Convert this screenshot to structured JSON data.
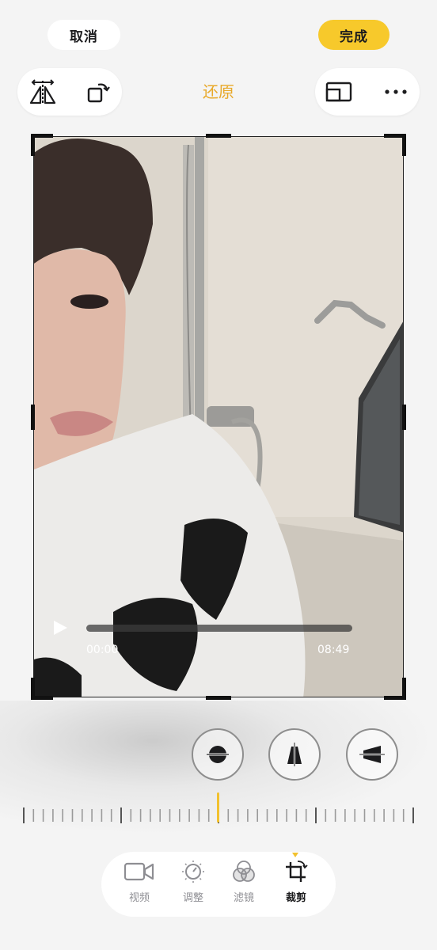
{
  "header": {
    "cancel_label": "取消",
    "done_label": "完成",
    "reset_label": "还原"
  },
  "toolbar": {
    "left_icons": [
      "flip-horizontal-icon",
      "rotate-icon"
    ],
    "right_icons": [
      "aspect-ratio-icon",
      "more-icon"
    ]
  },
  "video": {
    "current_time": "00:00",
    "duration": "08:49",
    "progress": 0
  },
  "adjust_buttons": [
    "straighten-icon",
    "vertical-perspective-icon",
    "horizontal-perspective-icon"
  ],
  "tabs": [
    {
      "label": "视频",
      "icon": "video-camera-icon"
    },
    {
      "label": "调整",
      "icon": "adjust-dial-icon"
    },
    {
      "label": "滤镜",
      "icon": "filters-icon"
    },
    {
      "label": "裁剪",
      "icon": "crop-rotate-icon",
      "active": true
    }
  ],
  "colors": {
    "accent": "#f7c92b",
    "reset_text": "#e8a92a",
    "background": "#f4f4f4"
  }
}
